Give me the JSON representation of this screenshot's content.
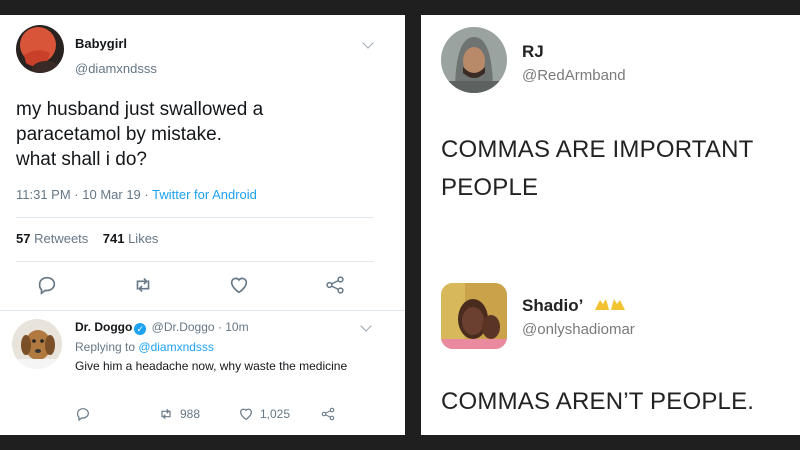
{
  "left_tweet": {
    "author_name": "Babygirl",
    "author_handle": "@diamxndsss",
    "text_lines": [
      "my husband just swallowed a",
      "paracetamol by mistake.",
      "what shall i do?"
    ],
    "time": "11:31 PM",
    "date": "10 Mar 19",
    "source": "Twitter for Android",
    "retweets_count": "57",
    "retweets_label": "Retweets",
    "likes_count": "741",
    "likes_label": "Likes"
  },
  "reply": {
    "author_name": "Dr. Doggo",
    "author_handle": "@Dr.Doggo",
    "age": "10m",
    "replying_prefix": "Replying to",
    "replying_to": "@diamxndsss",
    "text": "Give him a headache now, why waste the medicine",
    "retweets": "988",
    "likes": "1,025"
  },
  "right_tweet_1": {
    "author_name": "RJ",
    "author_handle": "@RedArmband",
    "text_lines": [
      "COMMAS ARE IMPORTANT",
      "PEOPLE"
    ]
  },
  "right_tweet_2": {
    "author_name": "Shadio’",
    "author_handle": "@onlyshadiomar",
    "text": "COMMAS AREN’T PEOPLE."
  },
  "icons": [
    "chevron-down-icon",
    "reply-icon",
    "retweet-icon",
    "like-icon",
    "share-icon",
    "verified-icon",
    "raised-hands-emoji"
  ],
  "colors": {
    "link": "#1da1f2",
    "secondary_text": "#657786",
    "background": "#1f1f1f",
    "panel": "#ffffff"
  }
}
